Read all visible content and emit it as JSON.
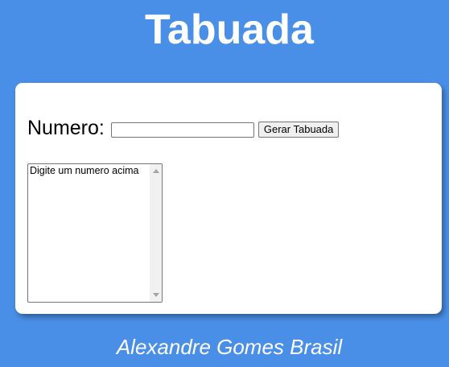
{
  "header": {
    "title": "Tabuada"
  },
  "form": {
    "number_label": "Numero:",
    "number_input": {
      "value": "",
      "placeholder": ""
    },
    "generate_button_label": "Gerar Tabuada"
  },
  "results": {
    "text": "Digite um numero acima"
  },
  "footer": {
    "author": "Alexandre Gomes Brasil"
  },
  "colors": {
    "background": "#4a8fe7",
    "card": "#ffffff",
    "text_light": "#ffffff"
  }
}
